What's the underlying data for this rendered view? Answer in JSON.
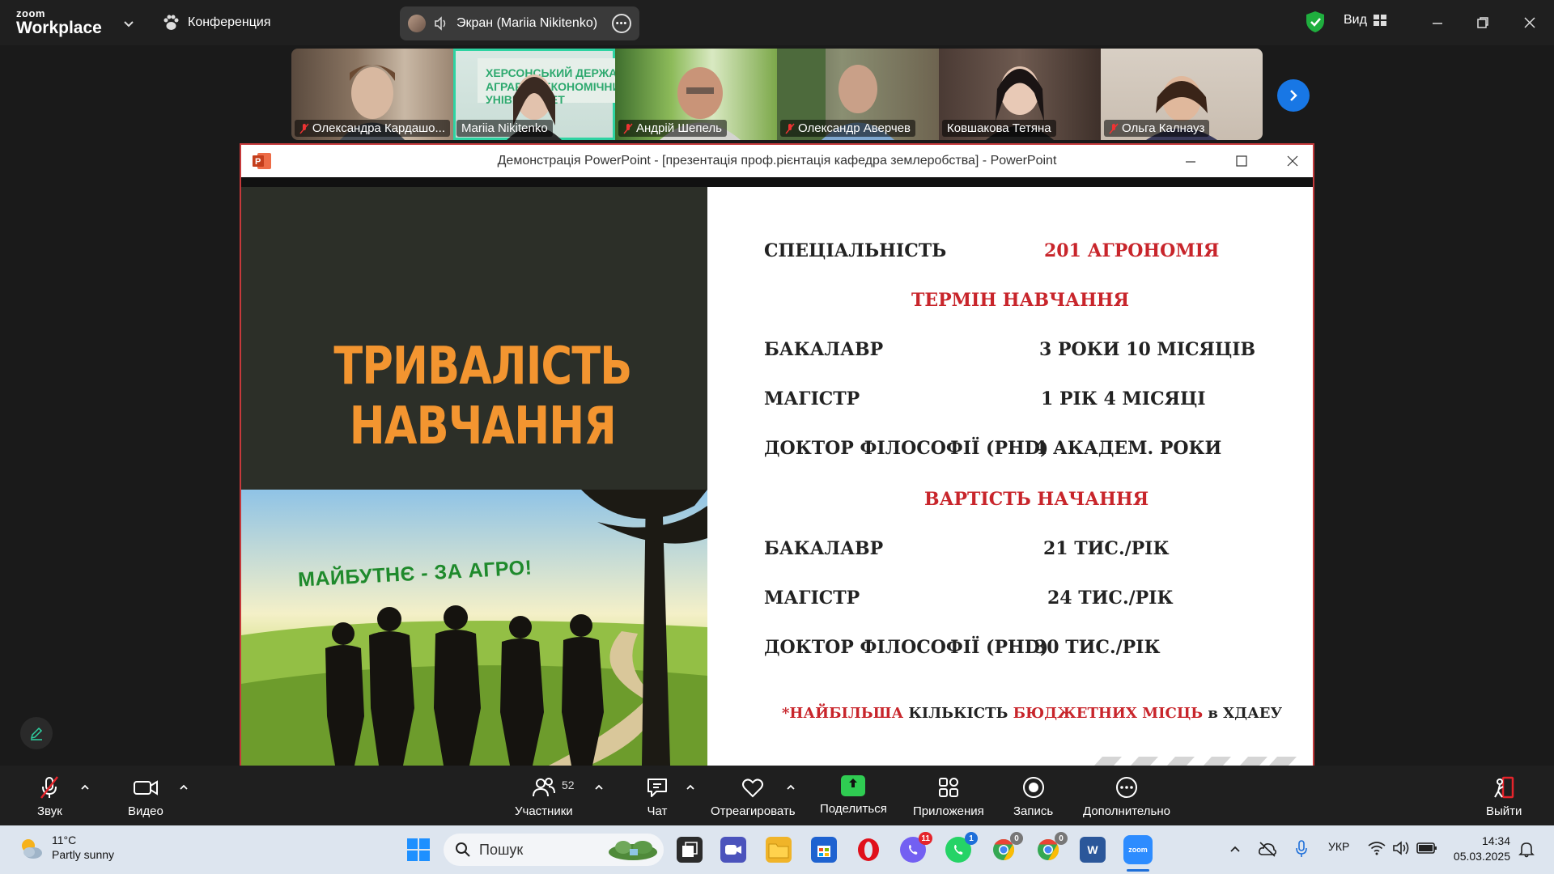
{
  "topbar": {
    "brand_small": "zoom",
    "brand_large": "Workplace",
    "meeting_label": "Конференция",
    "screen_label": "Экран (Mariia Nikitenko)",
    "view_label": "Вид"
  },
  "participants": [
    {
      "name": "Олександра Кардашо...",
      "muted": true,
      "active": false
    },
    {
      "name": "Mariia Nikitenko",
      "muted": false,
      "active": true
    },
    {
      "name": "Андрій Шепель",
      "muted": true,
      "active": false
    },
    {
      "name": "Олександр Аверчев",
      "muted": true,
      "active": false
    },
    {
      "name": "Ковшакова Тетяна",
      "muted": false,
      "active": false
    },
    {
      "name": "Ольга Калнауз",
      "muted": true,
      "active": false
    }
  ],
  "ppt": {
    "window_title": "Демонстрація PowerPoint - [презентація проф.рієнтація кафедра землеробства] - PowerPoint"
  },
  "slide": {
    "title_line1": "ТРИВАЛІСТЬ",
    "title_line2": "НАВЧАННЯ",
    "photo_caption": "МАЙБУТНЄ - ЗА АГРО!",
    "specialty_label": "СПЕЦІАЛЬНІСТЬ",
    "specialty_value": "201 АГРОНОМІЯ",
    "duration_heading": "ТЕРМІН НАВЧАННЯ",
    "duration_rows": [
      {
        "label": "БАКАЛАВР",
        "value": "3 РОКИ 10 МІСЯЦІВ"
      },
      {
        "label": "МАГІСТР",
        "value": "1 РІК 4 МІСЯЦІ"
      },
      {
        "label": "ДОКТОР ФІЛОСОФІЇ (PHD)",
        "value": "4 АКАДЕМ. РОКИ"
      }
    ],
    "cost_heading": "ВАРТІСТЬ НАЧАННЯ",
    "cost_rows": [
      {
        "label": "БАКАЛАВР",
        "value": "21 ТИС./РІК"
      },
      {
        "label": "МАГІСТР",
        "value": "24 ТИС./РІК"
      },
      {
        "label": "ДОКТОР ФІЛОСОФІЇ (PHD)",
        "value": "30 ТИС./РІК"
      }
    ],
    "note_part1": "*НАЙБІЛЬША",
    "note_part2": " КІЛЬКІСТЬ ",
    "note_part3": "БЮДЖЕТНИХ МІСЦЬ",
    "note_part4": " в ХДАЕУ"
  },
  "toolbar": {
    "audio": "Звук",
    "video": "Видео",
    "participants": "Участники",
    "participants_count": "52",
    "chat": "Чат",
    "react": "Отреагировать",
    "share": "Поделиться",
    "apps": "Приложения",
    "record": "Запись",
    "more": "Дополнительно",
    "leave": "Выйти"
  },
  "taskbar": {
    "temp": "11°C",
    "weather": "Partly sunny",
    "search_placeholder": "Пошук",
    "lang": "УКР",
    "time": "14:34",
    "date": "05.03.2025",
    "viber_badge": "11",
    "whatsapp_badge": "1",
    "chrome1_badge": "0",
    "chrome2_badge": "0"
  },
  "colors": {
    "accent_green": "#2ed3a2",
    "slide_red": "#c8252b",
    "slide_orange": "#f39530",
    "share_green": "#2fcc52",
    "zoom_blue": "#1877e5"
  }
}
